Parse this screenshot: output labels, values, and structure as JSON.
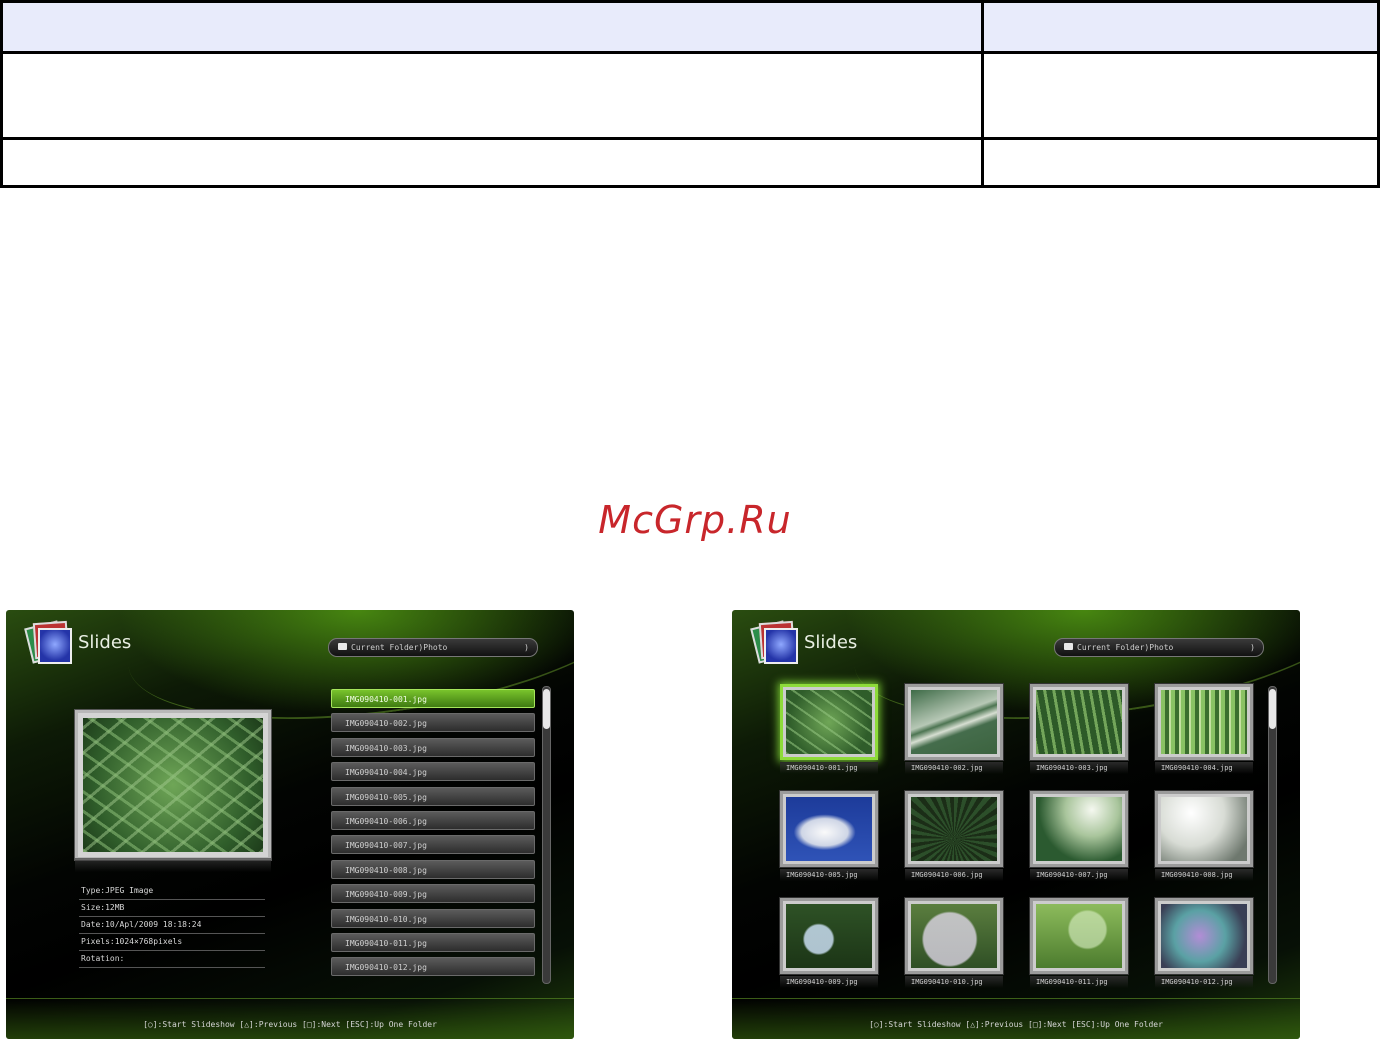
{
  "watermark": "McGrp.Ru",
  "list_view": {
    "app_title": "Slides",
    "folder_path": "Current Folder)Photo",
    "folder_chevron": ")",
    "info": {
      "type": "Type:JPEG Image",
      "size": "Size:12MB",
      "date": "Date:10/Apl/2009 18:18:24",
      "pixels": "Pixels:1024×768pixels",
      "rotation": "Rotation:"
    },
    "files": [
      "IMG090410-001.jpg",
      "IMG090410-002.jpg",
      "IMG090410-003.jpg",
      "IMG090410-004.jpg",
      "IMG090410-005.jpg",
      "IMG090410-006.jpg",
      "IMG090410-007.jpg",
      "IMG090410-008.jpg",
      "IMG090410-009.jpg",
      "IMG090410-010.jpg",
      "IMG090410-011.jpg",
      "IMG090410-012.jpg"
    ],
    "selected_index": 0,
    "hint": "[○]:Start Slideshow  [△]:Previous  [□]:Next  [ESC]:Up One Folder"
  },
  "grid_view": {
    "app_title": "Slides",
    "folder_path": "Current Folder)Photo",
    "folder_chevron": ")",
    "thumbs": [
      "IMG090410-001.jpg",
      "IMG090410-002.jpg",
      "IMG090410-003.jpg",
      "IMG090410-004.jpg",
      "IMG090410-005.jpg",
      "IMG090410-006.jpg",
      "IMG090410-007.jpg",
      "IMG090410-008.jpg",
      "IMG090410-009.jpg",
      "IMG090410-010.jpg",
      "IMG090410-011.jpg",
      "IMG090410-012.jpg"
    ],
    "selected_index": 0,
    "hint": "[○]:Start Slideshow  [△]:Previous  [□]:Next  [ESC]:Up One Folder"
  },
  "colors": {
    "accent_green": "#79c42c",
    "table_header_bg": "#e8ebfb",
    "watermark": "#c8262b"
  }
}
